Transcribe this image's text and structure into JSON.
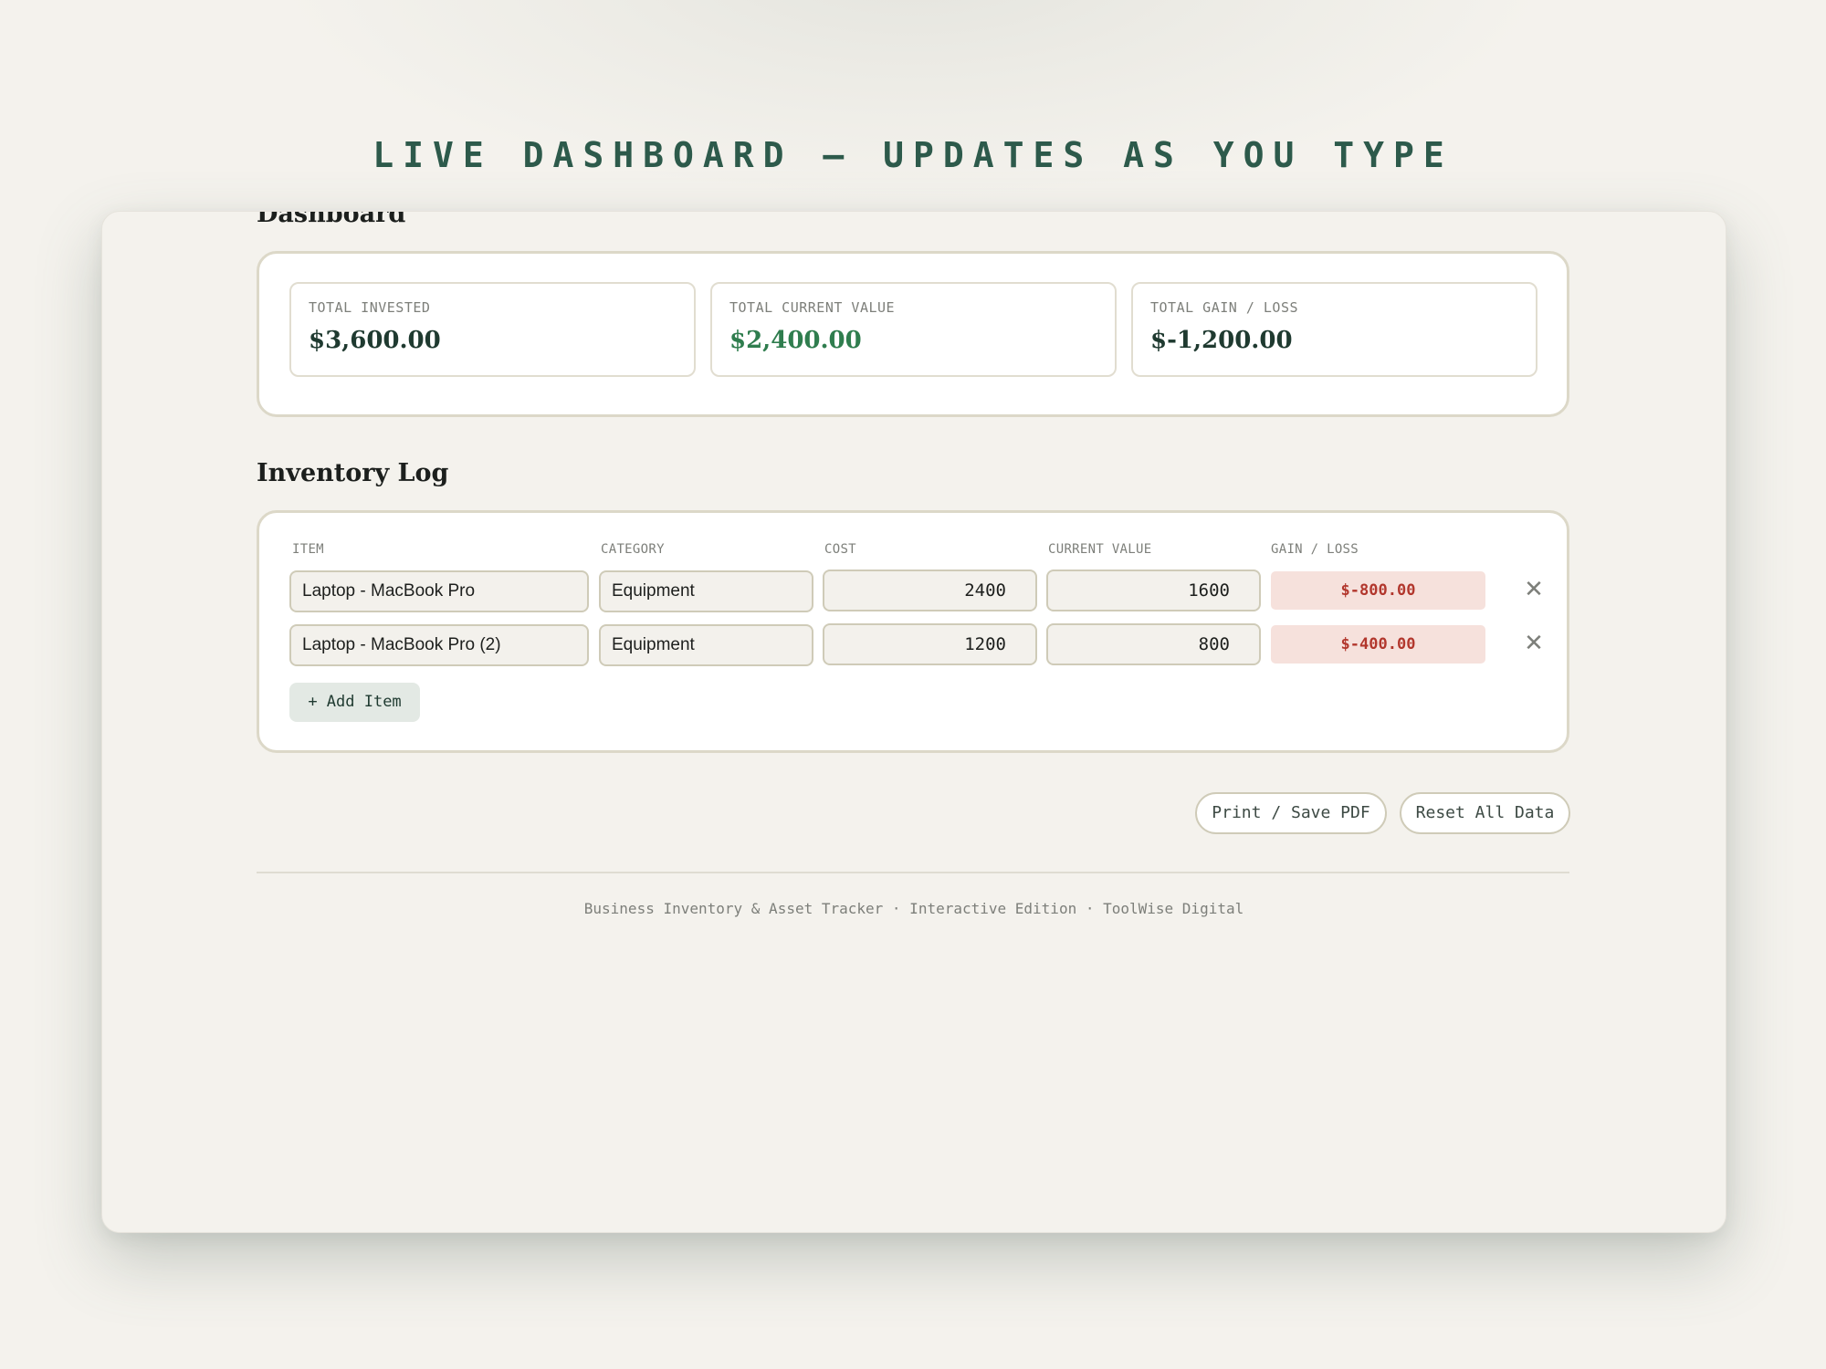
{
  "banner": "LIVE DASHBOARD — UPDATES AS YOU TYPE",
  "dashboard": {
    "title": "Dashboard",
    "stats": [
      {
        "label": "TOTAL INVESTED",
        "value": "$3,600.00",
        "color": "#1f3a30"
      },
      {
        "label": "TOTAL CURRENT VALUE",
        "value": "$2,400.00",
        "color": "#2f7d4e"
      },
      {
        "label": "TOTAL GAIN / LOSS",
        "value": "$-1,200.00",
        "color": "#1f3a30"
      }
    ]
  },
  "inventory": {
    "title": "Inventory Log",
    "columns": [
      "ITEM",
      "CATEGORY",
      "COST",
      "CURRENT VALUE",
      "GAIN / LOSS"
    ],
    "rows": [
      {
        "item": "Laptop - MacBook Pro",
        "category": "Equipment",
        "cost": "2400",
        "current_value": "1600",
        "gain_loss": "$-800.00",
        "remove_icon": "close-icon"
      },
      {
        "item": "Laptop - MacBook Pro (2)",
        "category": "Equipment",
        "cost": "1200",
        "current_value": "800",
        "gain_loss": "$-400.00",
        "remove_icon": "close-icon"
      }
    ],
    "remove_glyph": "✕",
    "add_label": "+ Add Item"
  },
  "actions": {
    "print_label": "Print / Save PDF",
    "reset_label": "Reset All Data"
  },
  "footer": "Business Inventory & Asset Tracker · Interactive Edition · ToolWise Digital",
  "colors": {
    "accent": "#2d5a4b",
    "positive": "#2f7d4e",
    "negative": "#b2372d",
    "negative_bg": "#f6e1dc"
  }
}
